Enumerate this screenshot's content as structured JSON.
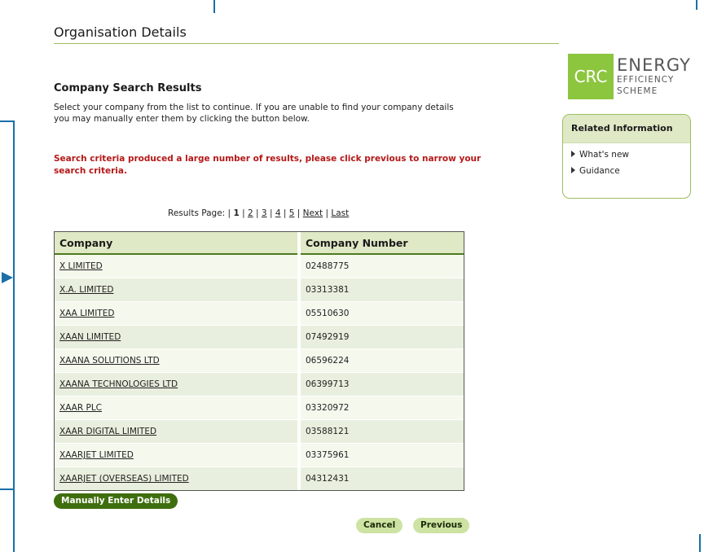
{
  "page": {
    "title": "Organisation Details",
    "section_heading": "Company Search Results",
    "intro": "Select your company from the list to continue. If you are unable to find your company details you may manually enter them by clicking the button below.",
    "warning": "Search criteria produced a large number of results, please click previous to narrow your search criteria."
  },
  "pager": {
    "label": "Results Page: |",
    "current": "1",
    "pages": [
      "2",
      "3",
      "4",
      "5"
    ],
    "next": "Next",
    "last": "Last",
    "separator": "|"
  },
  "table": {
    "headers": [
      "Company",
      "Company Number"
    ],
    "rows": [
      {
        "company": "X LIMITED",
        "number": "02488775"
      },
      {
        "company": "X.A. LIMITED",
        "number": "03313381"
      },
      {
        "company": "XAA LIMITED",
        "number": "05510630"
      },
      {
        "company": "XAAN LIMITED",
        "number": "07492919"
      },
      {
        "company": "XAANA SOLUTIONS LTD",
        "number": "06596224"
      },
      {
        "company": "XAANA TECHNOLOGIES LTD",
        "number": "06399713"
      },
      {
        "company": "XAAR PLC",
        "number": "03320972"
      },
      {
        "company": "XAAR DIGITAL LIMITED",
        "number": "03588121"
      },
      {
        "company": "XAARJET LIMITED",
        "number": "03375961"
      },
      {
        "company": "XAARJET (OVERSEAS) LIMITED",
        "number": "04312431"
      }
    ]
  },
  "buttons": {
    "manual": "Manually Enter Details",
    "cancel": "Cancel",
    "previous": "Previous"
  },
  "logo": {
    "badge": "CRC",
    "line1": "ENERGY",
    "line2": "EFFICIENCY",
    "line3": "SCHEME"
  },
  "related": {
    "title": "Related Information",
    "links": [
      "What's new",
      "Guidance"
    ]
  },
  "colors": {
    "accent_green": "#3f6e0e",
    "light_green": "#dfe9c6",
    "warning_red": "#b51818",
    "frame_blue": "#1a6fa8"
  }
}
